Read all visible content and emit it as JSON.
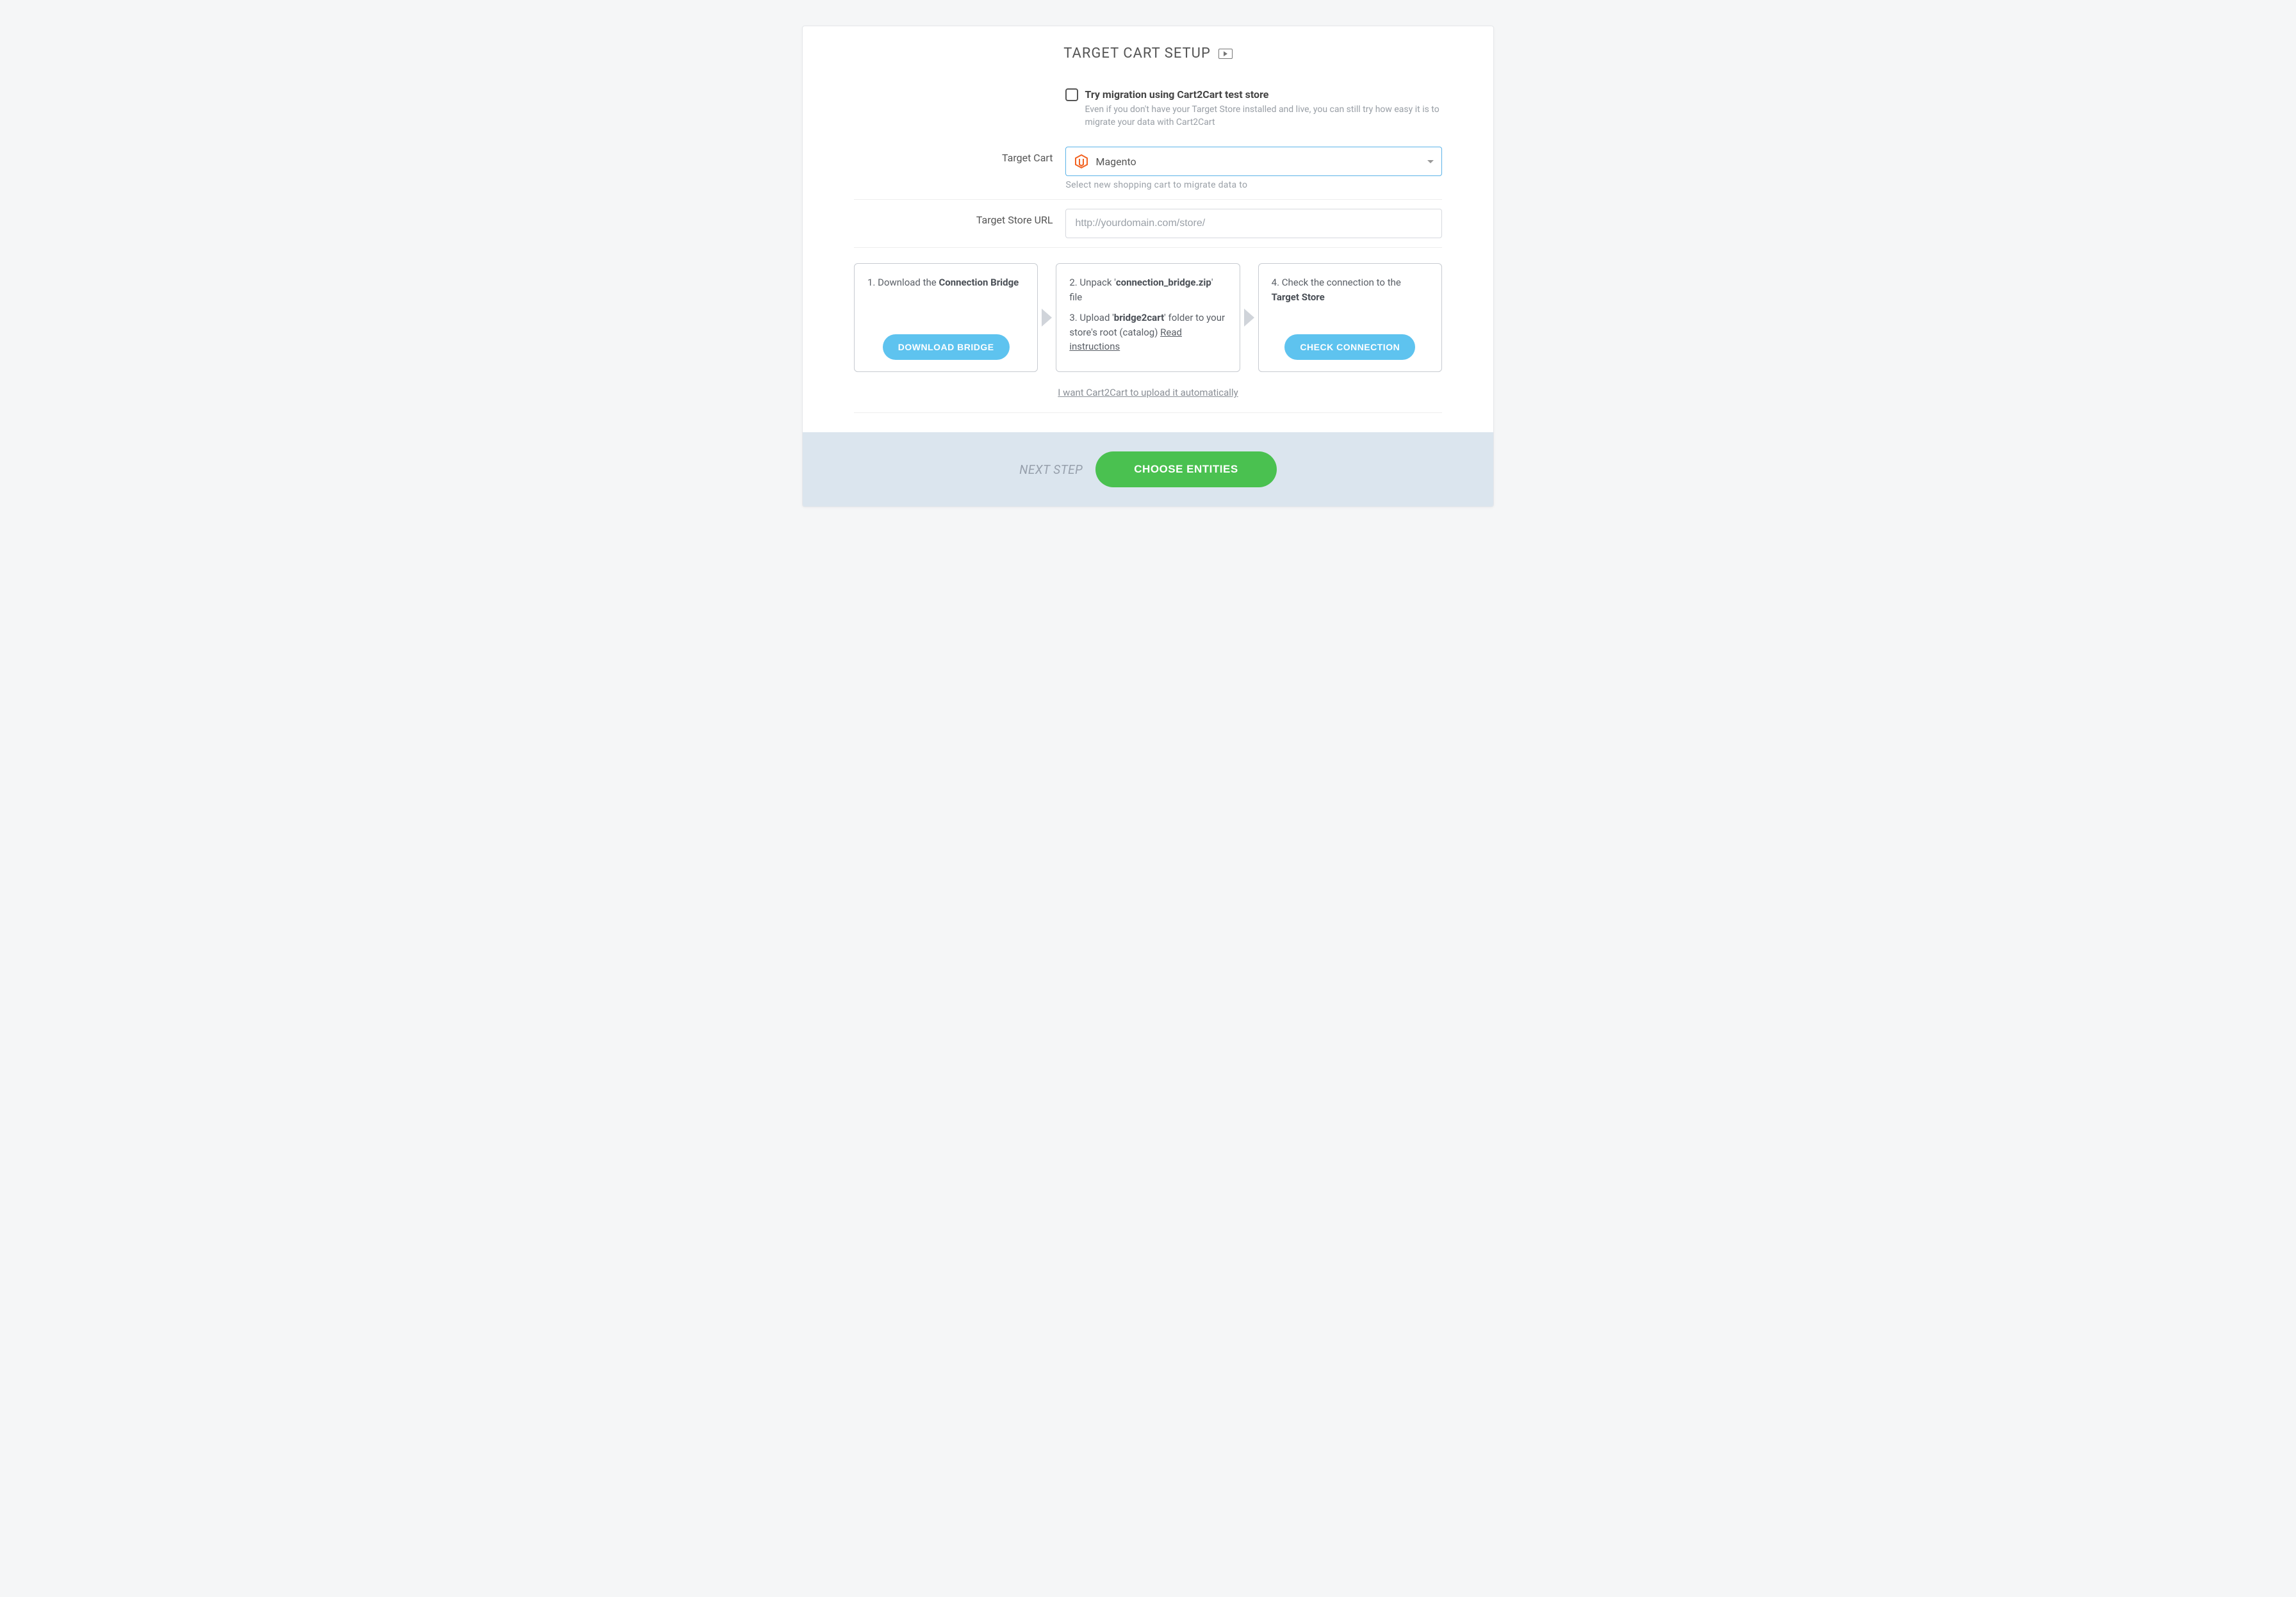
{
  "title": "TARGET CART SETUP",
  "checkbox": {
    "label": "Try migration using Cart2Cart test store",
    "hint": "Even if you don't have your Target Store installed and live, you can still try how easy it is to migrate your data with Cart2Cart"
  },
  "targetCart": {
    "label": "Target Cart",
    "selected": "Magento",
    "hint": "Select new shopping cart to migrate data to"
  },
  "targetUrl": {
    "label": "Target Store URL",
    "placeholder": "http://yourdomain.com/store/"
  },
  "steps": {
    "s1": {
      "prefix": "1. Download the ",
      "bold": "Connection Bridge",
      "button": "DOWNLOAD BRIDGE"
    },
    "s2": {
      "line2a": "2. Unpack '",
      "line2b": "connection_bridge.zip",
      "line2c": "' file",
      "line3a": "3. Upload '",
      "line3b": "bridge2cart",
      "line3c": "' folder to your store's root (catalog) ",
      "link": "Read instructions"
    },
    "s4": {
      "prefix": "4. Check the connection to the ",
      "bold": "Target Store",
      "button": "CHECK CONNECTION"
    }
  },
  "autoLink": "I want Cart2Cart to upload it automatically",
  "footer": {
    "label": "NEXT STEP",
    "button": "CHOOSE ENTITIES"
  }
}
